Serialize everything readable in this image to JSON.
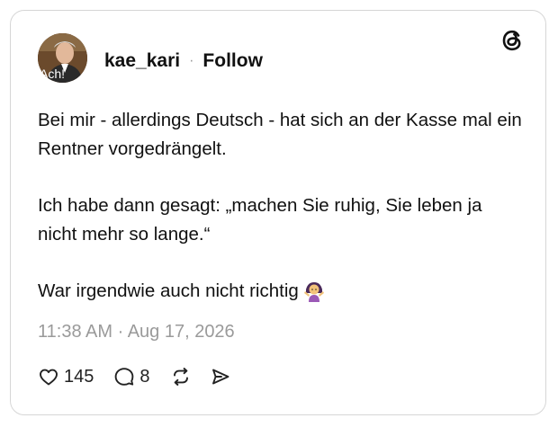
{
  "post": {
    "avatar_caption": "Ach!",
    "username": "kae_kari",
    "separator": "·",
    "follow_label": "Follow",
    "paragraphs": [
      "Bei mir - allerdings Deutsch - hat sich an der Kasse mal ein Rentner vorgedrängelt.",
      "Ich habe dann gesagt: „machen Sie ruhig, Sie leben ja nicht mehr so lange.“",
      "War irgendwie auch nicht richtig"
    ],
    "emoji_icon": "person-shrugging-emoji",
    "timestamp": "11:38 AM · Aug 17, 2026",
    "likes": "145",
    "replies": "8",
    "brand_icon": "threads-logo",
    "colors": {
      "text": "#111111",
      "muted": "#9a9a9a",
      "border": "#d6d6d6"
    }
  }
}
